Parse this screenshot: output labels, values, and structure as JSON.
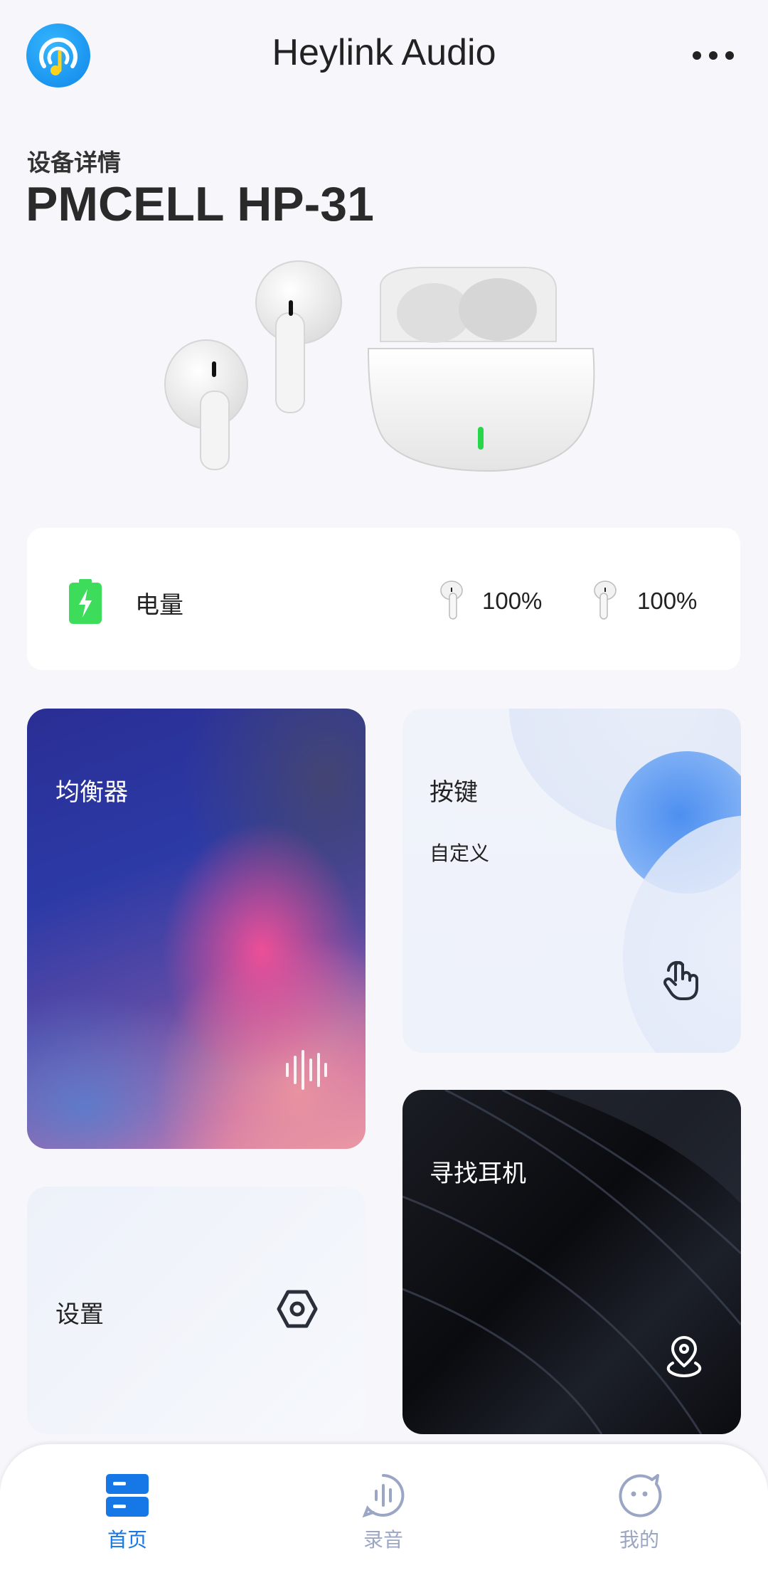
{
  "header": {
    "title": "Heylink Audio",
    "logo_icon": "music-note-logo-icon",
    "menu_icon": "more-horizontal-icon"
  },
  "device": {
    "section_label": "设备详情",
    "name": "PMCELL HP-31"
  },
  "battery": {
    "label": "电量",
    "left_percent": "100%",
    "right_percent": "100%",
    "level": 1.0
  },
  "tiles": {
    "equalizer": {
      "title": "均衡器",
      "icon": "waveform-icon"
    },
    "keys": {
      "title": "按键",
      "subtitle": "自定义",
      "icon": "touch-hand-icon"
    },
    "find": {
      "title": "寻找耳机",
      "icon": "location-pin-icon"
    },
    "settings": {
      "title": "设置",
      "icon": "hexagon-settings-icon"
    }
  },
  "tabs": [
    {
      "label": "首页",
      "icon": "home-icon",
      "active": true
    },
    {
      "label": "录音",
      "icon": "recording-icon",
      "active": false
    },
    {
      "label": "我的",
      "icon": "profile-chat-icon",
      "active": false
    }
  ],
  "colors": {
    "accent": "#1677e6",
    "battery_green": "#3ddc5a",
    "tab_inactive": "#9aa6c4"
  }
}
